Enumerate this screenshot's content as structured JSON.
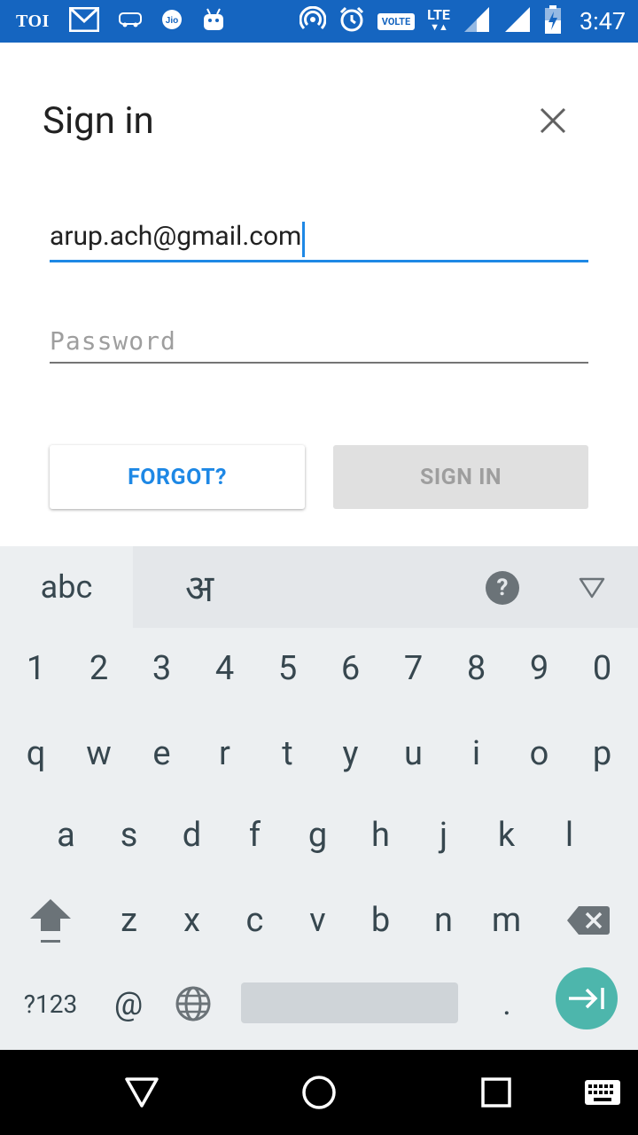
{
  "status_bar": {
    "left_label": "TOI",
    "network_badge": "VOLTE",
    "network_type": "LTE",
    "time": "3:47",
    "icons": [
      "toi-icon",
      "gmail-icon",
      "redbus-icon",
      "jio-icon",
      "android-icon",
      "hotspot-icon",
      "alarm-icon",
      "volte-icon",
      "lte-icon",
      "signal-icon",
      "signal-icon",
      "battery-charging-icon"
    ]
  },
  "dialog": {
    "title": "Sign in",
    "email_value": "arup.ach@gmail.com",
    "password_placeholder": "Password",
    "forgot_label": "FORGOT?",
    "sign_in_label": "SIGN IN"
  },
  "keyboard": {
    "tab_abc": "abc",
    "tab_hindi": "अ",
    "row_numbers": [
      "1",
      "2",
      "3",
      "4",
      "5",
      "6",
      "7",
      "8",
      "9",
      "0"
    ],
    "row_q": [
      "q",
      "w",
      "e",
      "r",
      "t",
      "y",
      "u",
      "i",
      "o",
      "p"
    ],
    "row_a": [
      "a",
      "s",
      "d",
      "f",
      "g",
      "h",
      "j",
      "k",
      "l"
    ],
    "row_z": [
      "z",
      "x",
      "c",
      "v",
      "b",
      "n",
      "m"
    ],
    "symbols_label": "?123",
    "at_label": "@",
    "period_label": "."
  },
  "colors": {
    "status_bar": "#1565C0",
    "accent": "#1E88E5",
    "enter_key": "#4DB6AC",
    "keyboard_bg": "#ECEFF1"
  }
}
